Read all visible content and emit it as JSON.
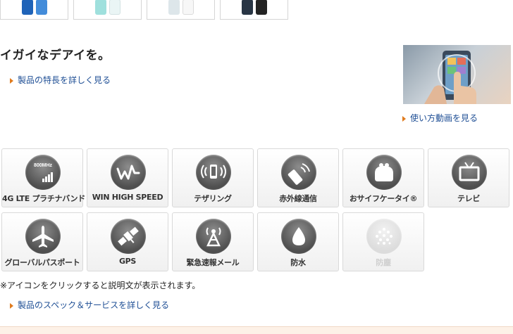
{
  "thumbnails": [
    {
      "name": "phone-blue",
      "colors": [
        "#1f63b8",
        "#2f7fd6"
      ]
    },
    {
      "name": "phone-mint",
      "colors": [
        "#9fe0dd",
        "#e8f5f5"
      ]
    },
    {
      "name": "phone-white",
      "colors": [
        "#dde6ea",
        "#f7f7f7"
      ]
    },
    {
      "name": "phone-black",
      "colors": [
        "#283544",
        "#0b0b0b"
      ]
    }
  ],
  "headline": "イガイなデアイを。",
  "links": {
    "features": "製品の特長を詳しく見る",
    "video": "使い方動画を見る",
    "spec": "製品のスペック＆サービスを詳しく見る"
  },
  "tiles": [
    {
      "label": "4G LTE プラチナバンド",
      "icon": "lte-platinum-band-icon",
      "icon_text": "800MHz",
      "enabled": true
    },
    {
      "label": "WIN HIGH SPEED",
      "icon": "win-high-speed-icon",
      "enabled": true
    },
    {
      "label": "テザリング",
      "icon": "tethering-icon",
      "enabled": true
    },
    {
      "label": "赤外線通信",
      "icon": "infrared-icon",
      "enabled": true
    },
    {
      "label": "おサイフケータイ®",
      "icon": "osaifu-keitai-icon",
      "enabled": true
    },
    {
      "label": "テレビ",
      "icon": "tv-icon",
      "enabled": true
    },
    {
      "label": "グローバルパスポート",
      "icon": "global-passport-icon",
      "enabled": true
    },
    {
      "label": "GPS",
      "icon": "gps-satellite-icon",
      "enabled": true
    },
    {
      "label": "緊急速報メール",
      "icon": "emergency-alert-mail-icon",
      "enabled": true
    },
    {
      "label": "防水",
      "icon": "waterproof-icon",
      "enabled": true
    },
    {
      "label": "防塵",
      "icon": "dustproof-icon",
      "enabled": false
    }
  ],
  "note": "※アイコンをクリックすると説明文が表示されます。",
  "colors": {
    "link": "#1f4f95",
    "arrow": "#e07b1e",
    "icon_dark": "#4f4f4f",
    "band": "#fdf1e7"
  }
}
